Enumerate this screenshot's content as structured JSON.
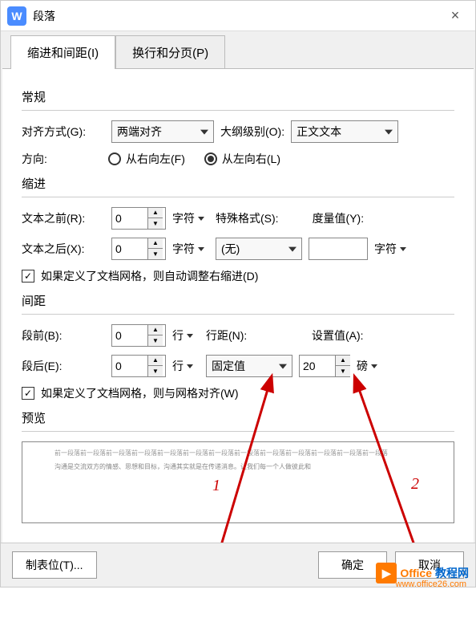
{
  "titlebar": {
    "app_glyph": "W",
    "title": "段落",
    "close": "×"
  },
  "tabs": {
    "tab1": "缩进和间距(I)",
    "tab2": "换行和分页(P)"
  },
  "general": {
    "section": "常规",
    "align_label": "对齐方式(G):",
    "align_value": "两端对齐",
    "outline_label": "大纲级别(O):",
    "outline_value": "正文文本",
    "direction_label": "方向:",
    "rtl": "从右向左(F)",
    "ltr": "从左向右(L)"
  },
  "indent": {
    "section": "缩进",
    "before_label": "文本之前(R):",
    "before_value": "0",
    "before_unit": "字符",
    "after_label": "文本之后(X):",
    "after_value": "0",
    "after_unit": "字符",
    "special_label": "特殊格式(S):",
    "special_value": "(无)",
    "measure_label": "度量值(Y):",
    "measure_value": "",
    "measure_unit": "字符",
    "checkbox": "如果定义了文档网格，则自动调整右缩进(D)"
  },
  "spacing": {
    "section": "间距",
    "before_para": "段前(B):",
    "before_value": "0",
    "before_unit": "行",
    "after_para": "段后(E):",
    "after_value": "0",
    "after_unit": "行",
    "line_spacing": "行距(N):",
    "line_value": "固定值",
    "set_value_label": "设置值(A):",
    "set_value": "20",
    "set_unit": "磅",
    "checkbox": "如果定义了文档网格，则与网格对齐(W)"
  },
  "preview": {
    "section": "预览",
    "line1": "前一段落前一段落前一段落前一段落前一段落前一段落前一段落前一段落前一段落前一段落前一段落前一段落前一段落",
    "line2": "沟通是交流双方的情感、思想和目标，沟通其实就是在传递消息。让我们每一个人做彼此和"
  },
  "annotations": {
    "num1": "1",
    "num2": "2"
  },
  "footer": {
    "tabstops": "制表位(T)...",
    "ok": "确定",
    "cancel": "取消"
  },
  "watermark": {
    "glyph": "▶",
    "text1": "Office",
    "text2": "教程网",
    "url": "www.office26.com"
  }
}
